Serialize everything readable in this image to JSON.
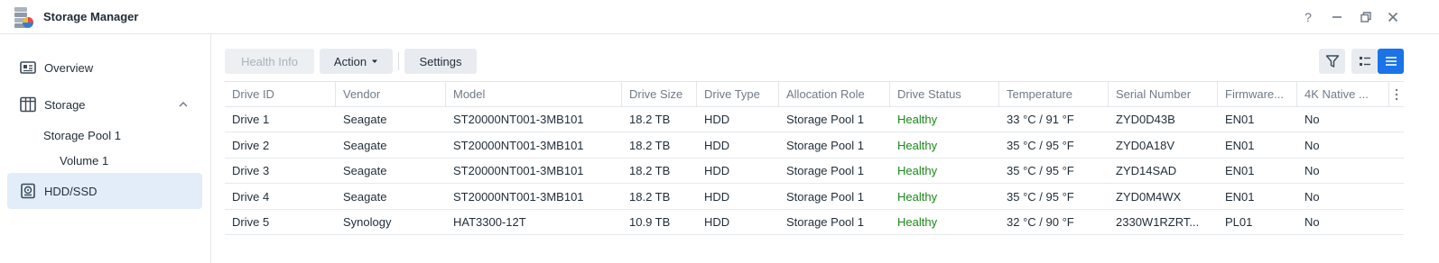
{
  "window": {
    "title": "Storage Manager",
    "controls": [
      "help-icon",
      "minimize-icon",
      "restore-icon",
      "close-icon"
    ]
  },
  "sidebar": {
    "items": [
      {
        "label": "Overview",
        "icon": "overview-icon"
      },
      {
        "label": "Storage",
        "icon": "storage-icon",
        "expanded": true
      },
      {
        "label": "Storage Pool 1"
      },
      {
        "label": "Volume 1"
      },
      {
        "label": "HDD/SSD",
        "icon": "hdd-icon",
        "active": true
      }
    ]
  },
  "toolbar": {
    "health_info": "Health Info",
    "action": "Action",
    "settings": "Settings"
  },
  "table": {
    "columns": [
      "Drive ID",
      "Vendor",
      "Model",
      "Drive Size",
      "Drive Type",
      "Allocation Role",
      "Drive Status",
      "Temperature",
      "Serial Number",
      "Firmware...",
      "4K Native ..."
    ],
    "rows": [
      [
        "Drive 1",
        "Seagate",
        "ST20000NT001-3MB101",
        "18.2 TB",
        "HDD",
        "Storage Pool 1",
        "Healthy",
        "33 °C / 91 °F",
        "ZYD0D43B",
        "EN01",
        "No"
      ],
      [
        "Drive 2",
        "Seagate",
        "ST20000NT001-3MB101",
        "18.2 TB",
        "HDD",
        "Storage Pool 1",
        "Healthy",
        "35 °C / 95 °F",
        "ZYD0A18V",
        "EN01",
        "No"
      ],
      [
        "Drive 3",
        "Seagate",
        "ST20000NT001-3MB101",
        "18.2 TB",
        "HDD",
        "Storage Pool 1",
        "Healthy",
        "35 °C / 95 °F",
        "ZYD14SAD",
        "EN01",
        "No"
      ],
      [
        "Drive 4",
        "Seagate",
        "ST20000NT001-3MB101",
        "18.2 TB",
        "HDD",
        "Storage Pool 1",
        "Healthy",
        "35 °C / 95 °F",
        "ZYD0M4WX",
        "EN01",
        "No"
      ],
      [
        "Drive 5",
        "Synology",
        "HAT3300-12T",
        "10.9 TB",
        "HDD",
        "Storage Pool 1",
        "Healthy",
        "32 °C / 90 °F",
        "2330W1RZRT...",
        "PL01",
        "No"
      ]
    ]
  },
  "colors": {
    "accent": "#1a73e8",
    "healthy": "#1a8a1a",
    "sidebar_active": "#e2edf9"
  }
}
